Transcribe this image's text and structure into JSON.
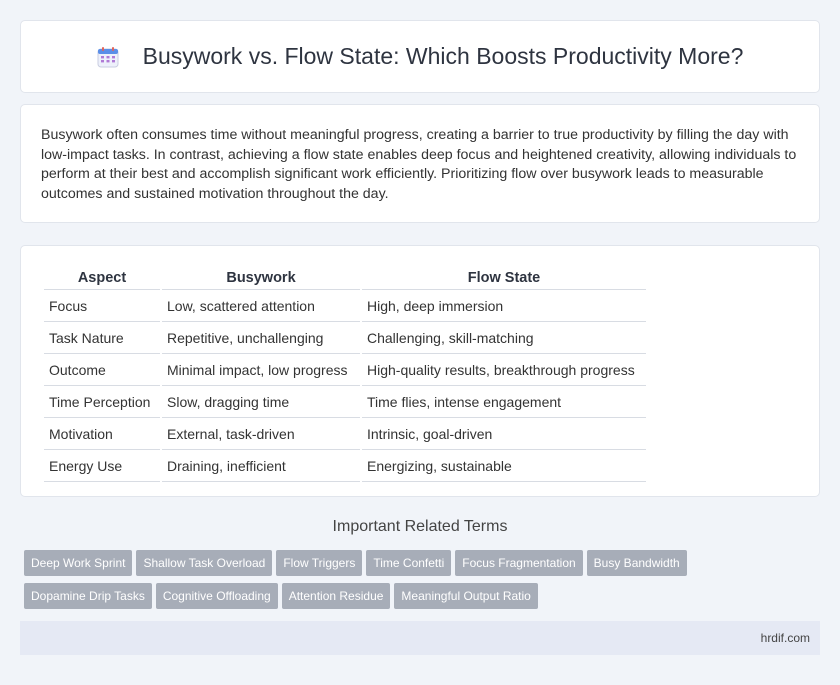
{
  "header": {
    "title": "Busywork vs. Flow State: Which Boosts Productivity More?",
    "icon": "calendar-icon"
  },
  "intro": {
    "text": "Busywork often consumes time without meaningful progress, creating a barrier to true productivity by filling the day with low-impact tasks. In contrast, achieving a flow state enables deep focus and heightened creativity, allowing individuals to perform at their best and accomplish significant work efficiently. Prioritizing flow over busywork leads to measurable outcomes and sustained motivation throughout the day."
  },
  "table": {
    "headers": [
      "Aspect",
      "Busywork",
      "Flow State"
    ],
    "rows": [
      [
        "Focus",
        "Low, scattered attention",
        "High, deep immersion"
      ],
      [
        "Task Nature",
        "Repetitive, unchallenging",
        "Challenging, skill-matching"
      ],
      [
        "Outcome",
        "Minimal impact, low progress",
        "High-quality results, breakthrough progress"
      ],
      [
        "Time Perception",
        "Slow, dragging time",
        "Time flies, intense engagement"
      ],
      [
        "Motivation",
        "External, task-driven",
        "Intrinsic, goal-driven"
      ],
      [
        "Energy Use",
        "Draining, inefficient",
        "Energizing, sustainable"
      ]
    ]
  },
  "related": {
    "title": "Important Related Terms",
    "tags": [
      "Deep Work Sprint",
      "Shallow Task Overload",
      "Flow Triggers",
      "Time Confetti",
      "Focus Fragmentation",
      "Busy Bandwidth",
      "Dopamine Drip Tasks",
      "Cognitive Offloading",
      "Attention Residue",
      "Meaningful Output Ratio"
    ]
  },
  "footer": {
    "site": "hrdif.com"
  },
  "colors": {
    "tag_bg": "#a7adb8",
    "page_bg": "#f1f4f9",
    "footer_bg": "#e5e9f4"
  }
}
